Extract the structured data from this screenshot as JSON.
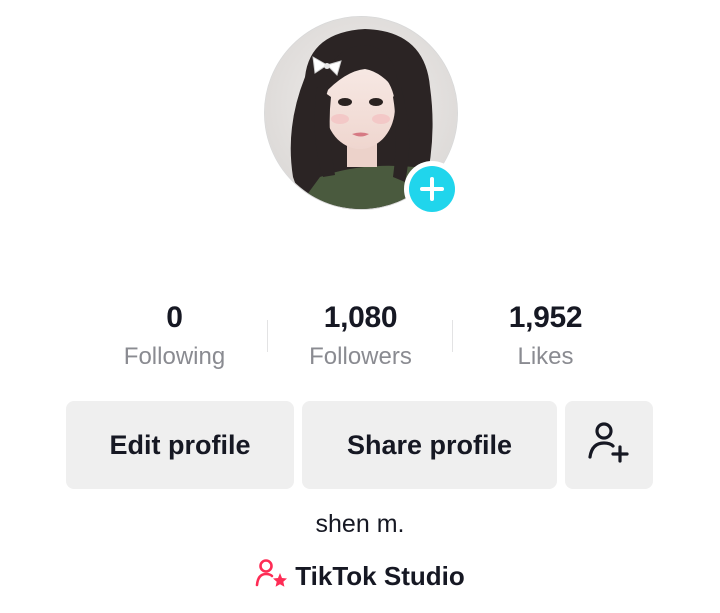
{
  "profile": {
    "display_name": "shen m.",
    "avatar_icon": "profile-photo",
    "add_avatar_icon": "plus-icon",
    "accent_color": "#20d5ec"
  },
  "stats": [
    {
      "value": "0",
      "label": "Following"
    },
    {
      "value": "1,080",
      "label": "Followers"
    },
    {
      "value": "1,952",
      "label": "Likes"
    }
  ],
  "actions": {
    "edit_profile": "Edit profile",
    "share_profile": "Share profile",
    "add_friend_icon": "person-add-icon"
  },
  "studio": {
    "label": "TikTok Studio",
    "icon": "creator-star-icon",
    "icon_color": "#fe2c55"
  }
}
